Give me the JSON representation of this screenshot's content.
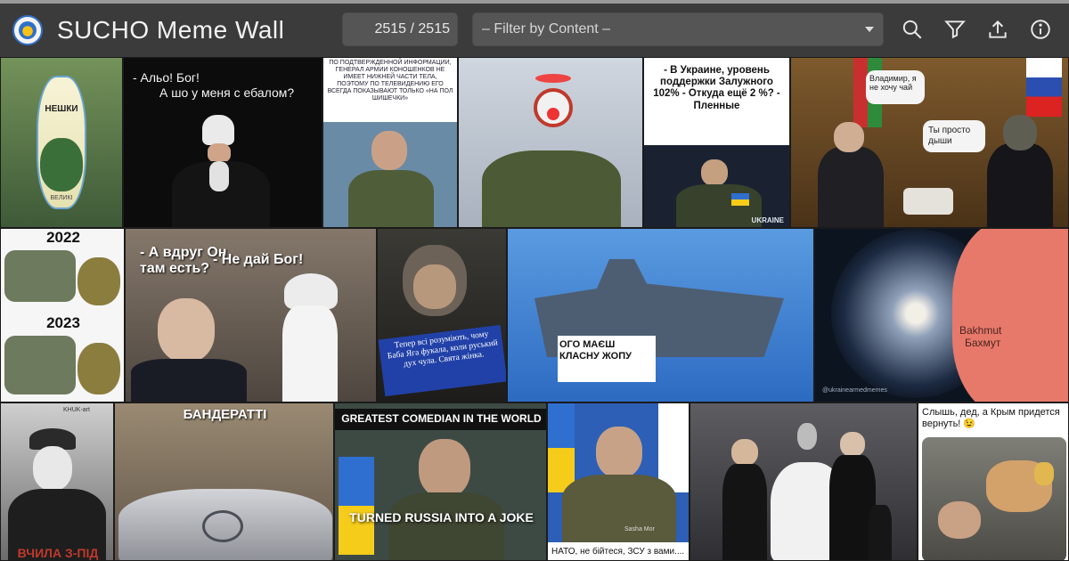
{
  "header": {
    "title": "SUCHO Meme Wall",
    "counter": "2515 / 2515",
    "filter_placeholder": "– Filter by Content –",
    "tools": [
      "search-icon",
      "filter-icon",
      "upload-icon",
      "info-icon"
    ]
  },
  "tiles": {
    "t1": {
      "text": "НЕШКИ",
      "sub": "ВЕЛИКІ"
    },
    "t2": {
      "line1": "- Альо! Бог!",
      "line2": "А шо у меня с ебалом?"
    },
    "t3": {
      "text": "ПО ПОДТВЕРЖДЕННОЙ ИНФОРМАЦИИ, ГЕНЕРАЛ АРМИИ КОНОШЕНКОВ НЕ ИМЕЕТ НИЖНЕЙ ЧАСТИ ТЕЛА, ПОЭТОМУ ПО ТЕЛЕВИДЕНИЮ ЕГО ВСЕГДА ПОКАЗЫВАЮТ ТОЛЬКО «НА ПОЛ ШИШЕЧКИ»"
    },
    "t5": {
      "text": "- В Украине, уровень поддержки Залужного 102% - Откуда ещё 2 %? - Пленные",
      "badge": "UKRAINE"
    },
    "t6": {
      "bubble1": "Владимир, я не хочу чай",
      "bubble2": "Ты просто дыши"
    },
    "t7": {
      "top": "2022",
      "bottom": "2023"
    },
    "t8": {
      "left": "- А вдруг Он там есть?",
      "right": "- Не дай Бог!"
    },
    "t9": {
      "text": "Тепер всі розуміють, чому Баба Яга фукала, коли руський дух чула. Свята жінка."
    },
    "t10": {
      "text": "ОГО МАЄШ КЛАСНУ ЖОПУ"
    },
    "t11": {
      "label1": "Bakhmut",
      "label2": "Бахмут",
      "watermark": "@ukrainearmedmemes"
    },
    "t12": {
      "small": "KHUK-art",
      "bottom": "ВЧИЛА З-ПІД"
    },
    "t13": {
      "text": "БАНДЕРАТТІ"
    },
    "t14": {
      "top": "GREATEST COMEDIAN IN THE WORLD",
      "bottom": "TURNED RUSSIA INTO A JOKE"
    },
    "t15": {
      "text": "НАТО, не бійтеся, ЗСУ з вами....",
      "badge": "Sasha Mor"
    },
    "t17": {
      "text": "Слышь, дед, а Крым придется вернуть! 😉"
    }
  }
}
